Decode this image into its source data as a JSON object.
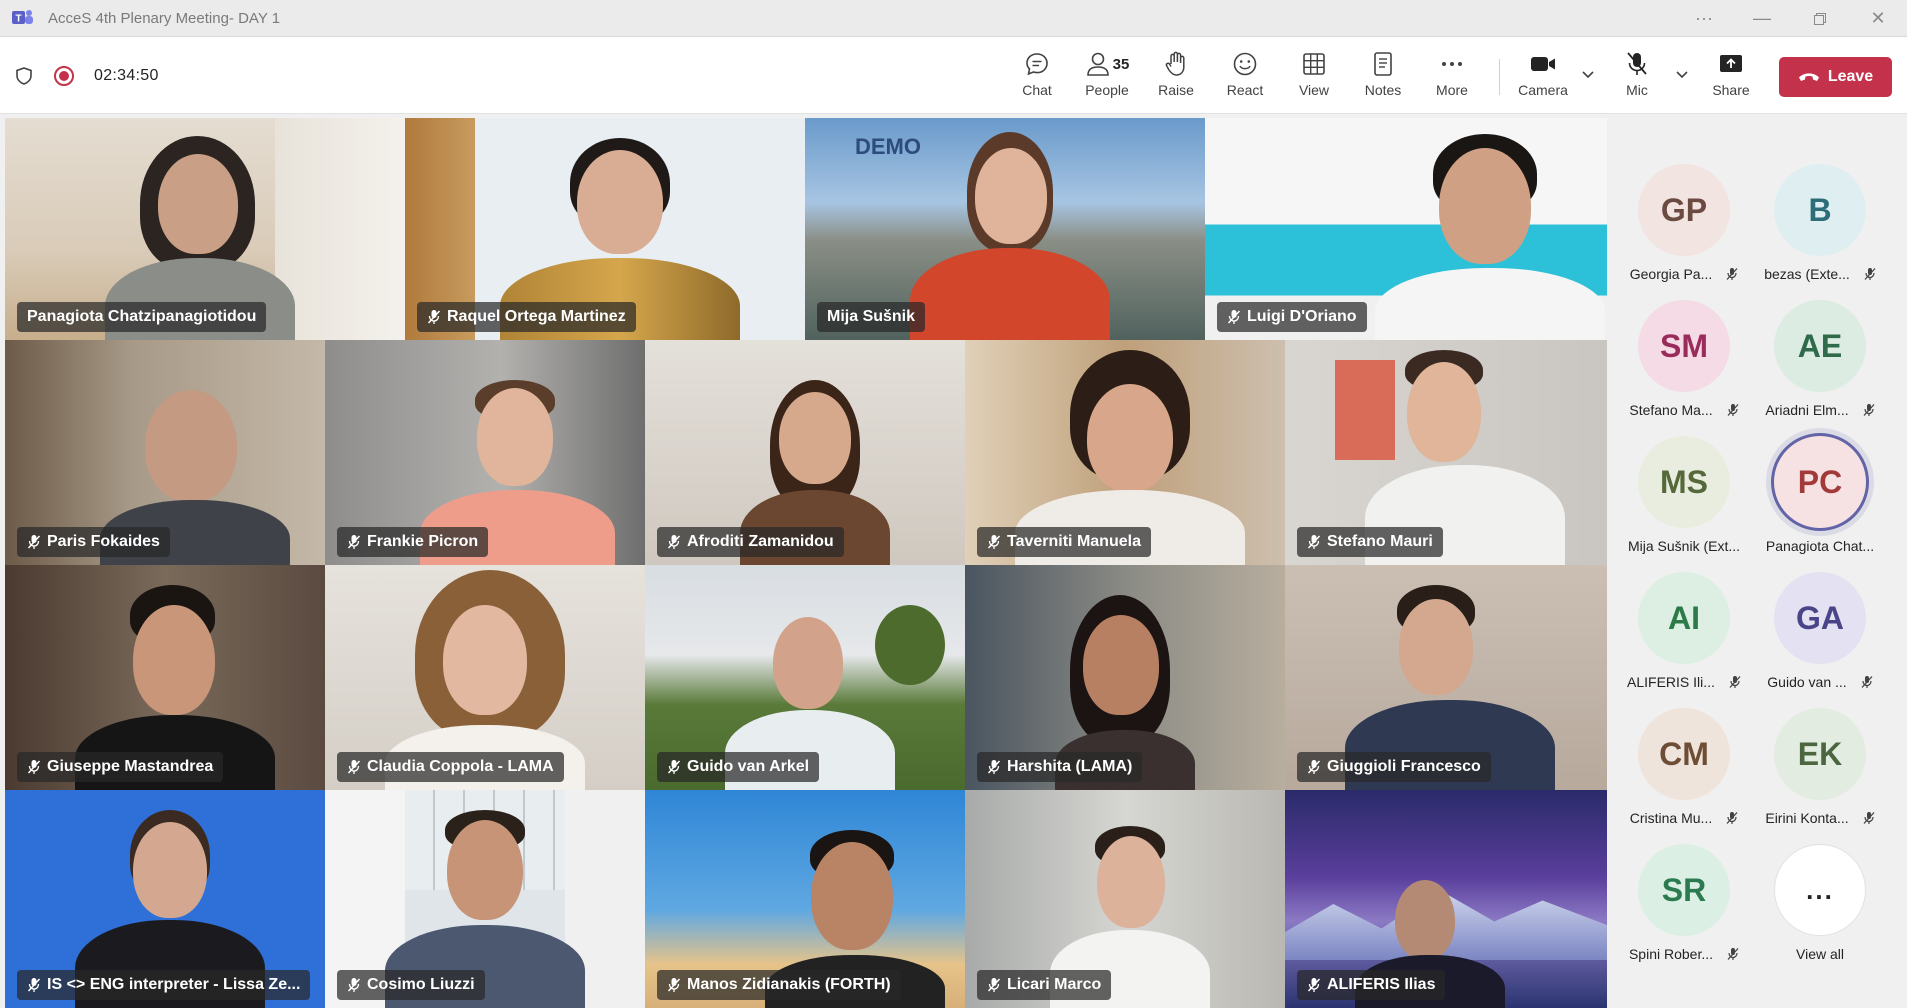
{
  "window": {
    "title": "AcceS 4th Plenary Meeting- DAY 1",
    "controls": [
      "more",
      "minimize",
      "restore",
      "close"
    ]
  },
  "toolbar": {
    "timer": "02:34:50",
    "people_count": "35",
    "buttons": [
      {
        "key": "chat",
        "label": "Chat",
        "icon": "chat-icon"
      },
      {
        "key": "people",
        "label": "People",
        "icon": "people-icon"
      },
      {
        "key": "raise",
        "label": "Raise",
        "icon": "raise-hand-icon"
      },
      {
        "key": "react",
        "label": "React",
        "icon": "react-icon"
      },
      {
        "key": "view",
        "label": "View",
        "icon": "grid-view-icon"
      },
      {
        "key": "notes",
        "label": "Notes",
        "icon": "notes-icon"
      },
      {
        "key": "more",
        "label": "More",
        "icon": "more-icon"
      },
      {
        "key": "camera",
        "label": "Camera",
        "icon": "camera-icon"
      },
      {
        "key": "mic",
        "label": "Mic",
        "icon": "mic-off-icon"
      },
      {
        "key": "share",
        "label": "Share",
        "icon": "share-icon"
      }
    ],
    "leave_label": "Leave"
  },
  "tiles": [
    {
      "name": "Panagiota Chatzipanagiotidou",
      "muted": false
    },
    {
      "name": "Raquel Ortega Martinez",
      "muted": true
    },
    {
      "name": "Mija Sušnik",
      "muted": false,
      "background_text": "DEMO"
    },
    {
      "name": "Luigi D'Oriano",
      "muted": true
    },
    {
      "name": "Paris Fokaides",
      "muted": true
    },
    {
      "name": "Frankie Picron",
      "muted": true
    },
    {
      "name": "Afroditi Zamanidou",
      "muted": true
    },
    {
      "name": "Taverniti Manuela",
      "muted": true
    },
    {
      "name": "Stefano Mauri",
      "muted": true
    },
    {
      "name": "Giuseppe Mastandrea",
      "muted": true
    },
    {
      "name": "Claudia Coppola - LAMA",
      "muted": true
    },
    {
      "name": "Guido van Arkel",
      "muted": true
    },
    {
      "name": "Harshita (LAMA)",
      "muted": true
    },
    {
      "name": "Giuggioli Francesco",
      "muted": true
    },
    {
      "name": "IS <> ENG interpreter - Lissa Ze...",
      "muted": true
    },
    {
      "name": "Cosimo Liuzzi",
      "muted": true
    },
    {
      "name": "Manos Zidianakis (FORTH)",
      "muted": true
    },
    {
      "name": "Licari Marco",
      "muted": true
    },
    {
      "name": "ALIFERIS Ilias",
      "muted": true
    }
  ],
  "roster": [
    {
      "initials": "GP",
      "name": "Georgia Pa...",
      "bg": "#f1e4e1",
      "fg": "#6b4a42"
    },
    {
      "initials": "B",
      "name": "bezas (Exte...",
      "bg": "#deeef1",
      "fg": "#2d6d7a"
    },
    {
      "initials": "SM",
      "name": "Stefano Ma...",
      "bg": "#f5dbe6",
      "fg": "#9a2c5c"
    },
    {
      "initials": "AE",
      "name": "Ariadni Elm...",
      "bg": "#dcece3",
      "fg": "#2f6a4b"
    },
    {
      "initials": "MS",
      "name": "Mija Sušnik (Ext...",
      "bg": "#e8eddf",
      "fg": "#55693a"
    },
    {
      "initials": "PC",
      "name": "Panagiota Chat...",
      "bg": "#f6e2e2",
      "fg": "#a33a3a"
    },
    {
      "initials": "AI",
      "name": "ALIFERIS Ili...",
      "bg": "#dcefe2",
      "fg": "#2c7a47"
    },
    {
      "initials": "GA",
      "name": "Guido van ...",
      "bg": "#e4e2f2",
      "fg": "#4a4488"
    },
    {
      "initials": "CM",
      "name": "Cristina Mu...",
      "bg": "#efe4dc",
      "fg": "#6e4d36"
    },
    {
      "initials": "EK",
      "name": "Eirini Konta...",
      "bg": "#e3ece0",
      "fg": "#4b6641"
    },
    {
      "initials": "SR",
      "name": "Spini Rober...",
      "bg": "#dcefe4",
      "fg": "#2c7a50"
    },
    {
      "initials": "...",
      "name": "View all",
      "bg": "#ffffff",
      "fg": "#242424"
    }
  ]
}
